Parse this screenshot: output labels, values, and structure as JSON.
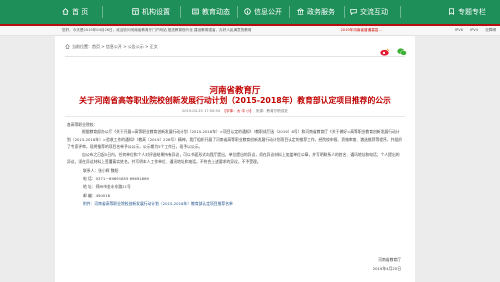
{
  "nav": {
    "items": [
      {
        "label": "首 页",
        "icon": "home-icon"
      },
      {
        "label": "机构设置",
        "icon": "org-icon"
      },
      {
        "label": "教育动态",
        "icon": "news-icon"
      },
      {
        "label": "信息公开",
        "icon": "info-icon"
      },
      {
        "label": "政务服务",
        "icon": "service-icon"
      },
      {
        "label": "交流互动",
        "icon": "chat-icon"
      },
      {
        "label": "专题专栏",
        "icon": "topic-icon"
      }
    ]
  },
  "ticker": {
    "text": "您好，今天是2019年04月26日，欢迎访问河南省教育厅门户网站 推进教育现代化 建设教育强省，办好人民满意的教育",
    "ext_link": "2019年河南省普通高招…",
    "links": [
      "IPV6",
      "IPV4",
      "无障碍"
    ]
  },
  "breadcrumb": [
    "首页",
    "信息公开",
    "公告公示",
    "正文"
  ],
  "share": {
    "icons": [
      "weibo-icon",
      "wechat-icon"
    ]
  },
  "article": {
    "title_line1": "河南省教育厅",
    "title_line2": "关于河南省高等职业院校创新发展行动计划（2015-2018年）教育部认定项目推荐的公示",
    "meta": {
      "date": "2019-04-25 17:50:54",
      "font_size": "【字体：大 中 小】",
      "source": "来源：教育厅职成处"
    },
    "paragraphs": [
      {
        "text": "各高等职业院校：",
        "style": "plain"
      },
      {
        "text": "根据教育部办公厅《关于开展<高等职业教育创新发展行动计划（2015-2018年）>项目认定的通知》（教职成厅函〔2019〕8号）和河南省教育厅《关于做好<高等职业教育创新发展行动计划（2015-2018年）>验收工作的通知》（教高〔2019〕228号）精神，我厅组织开展了河南省高等职业教育创新发展行动计划项目认定的推荐工作，经院校申报、资格审查、遴选推荐等程序，并组织了专家评审，现将推荐的项目名单予以公示，公示期为5个工作日，现予以公示。",
        "style": "indent"
      },
      {
        "text": "自公布之日起5日内，任何单位和个人对评选结果持有异议，可以书面形式向我厅提出，单位提出的异议，须在异议材料上加盖单位公章，并写明联系人的姓名、通讯地址和电话；个人提出的异议，须在异议材料上签署真实姓名，并写明本人工作单位、通讯地址和电话。不符合上述要求的异议，不予受理。",
        "style": "indent"
      },
      {
        "text": "联系人：张小辉 魏阳",
        "style": "indent2"
      },
      {
        "text": "电 话：0371－69691855 69691869",
        "style": "indent2"
      },
      {
        "text": "地 址：郑州市金水东路21号",
        "style": "indent2"
      },
      {
        "text": "邮 编：450018",
        "style": "indent2"
      },
      {
        "text": "附件：河南省高等职业院校创新发展行动计划（2015-2018年）教育部认定项目推荐名单",
        "style": "indent2"
      }
    ],
    "signature": {
      "org": "河南省教育厅",
      "date": "2019年4月25日"
    }
  }
}
